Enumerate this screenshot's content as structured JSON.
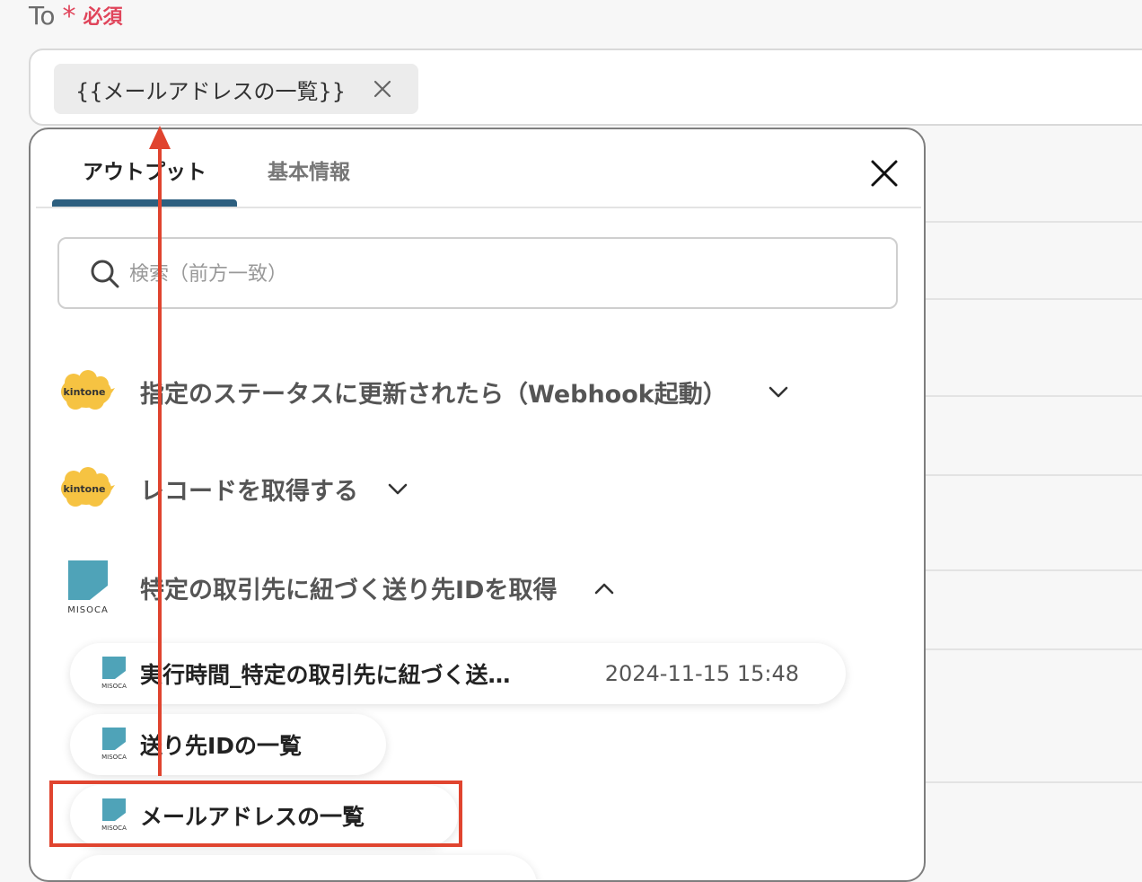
{
  "field": {
    "label": "To",
    "required_mark": "*",
    "required_text": "必須",
    "chip_value": "{{メールアドレスの一覧}}"
  },
  "panel": {
    "tabs": [
      {
        "label": "アウトプット",
        "active": true
      },
      {
        "label": "基本情報",
        "active": false
      }
    ],
    "search_placeholder": "検索（前方一致）",
    "groups": [
      {
        "logo": "kintone-logo",
        "logo_text": "kintone",
        "title": "指定のステータスに更新されたら（Webhook起動）",
        "expanded": false
      },
      {
        "logo": "kintone-logo",
        "logo_text": "kintone",
        "title": "レコードを取得する",
        "expanded": false
      },
      {
        "logo": "misoca-logo",
        "logo_text": "MISOCA",
        "title": "特定の取引先に紐づく送り先IDを取得",
        "expanded": true
      }
    ],
    "items": [
      {
        "title": "実行時間_特定の取引先に紐づく送…",
        "value": "2024-11-15 15:48"
      },
      {
        "title": "送り先IDの一覧"
      },
      {
        "title": "メールアドレスの一覧",
        "highlighted": true
      }
    ]
  },
  "colors": {
    "accent_tab": "#2d5f7f",
    "required": "#e0455b",
    "annotation": "#e0442f",
    "misoca": "#4fa3b8",
    "kintone": "#f6c342"
  }
}
